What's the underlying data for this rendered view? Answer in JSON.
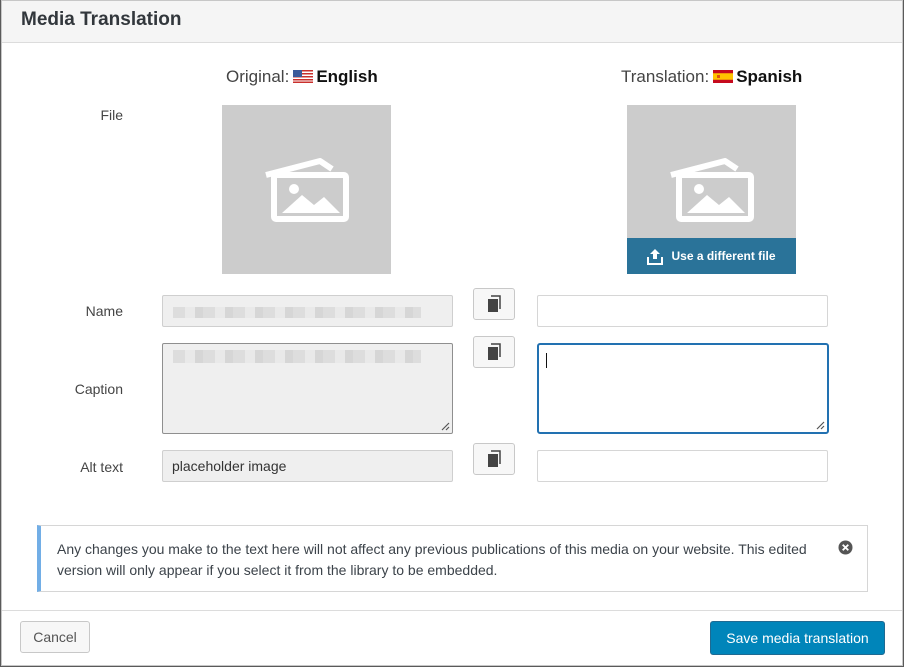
{
  "dialog": {
    "title": "Media Translation"
  },
  "original": {
    "prefix": "Original:",
    "language": "English",
    "flag": "us-flag"
  },
  "translation": {
    "prefix": "Translation:",
    "language": "Spanish",
    "flag": "es-flag"
  },
  "labels": {
    "file": "File",
    "name": "Name",
    "caption": "Caption",
    "alt_text": "Alt text"
  },
  "file": {
    "use_different_label": "Use a different file",
    "placeholder_icon": "image-placeholder-icon",
    "upload_icon": "upload-icon"
  },
  "fields": {
    "original_alt_text": "placeholder image",
    "translation_name": "",
    "translation_caption": "",
    "translation_alt_text": ""
  },
  "copy_icon": "copy-icon",
  "notice": {
    "text": "Any changes you make to the text here will not affect any previous publications of this media on your website. This edited version will only appear if you select it from the library to be embedded.",
    "close_icon": "dismiss-icon"
  },
  "footer": {
    "cancel_label": "Cancel",
    "save_label": "Save media translation"
  },
  "colors": {
    "primary": "#0085ba",
    "use_file_bar": "#2a7399",
    "notice_accent": "#72aee6",
    "focus": "#2271b1"
  }
}
